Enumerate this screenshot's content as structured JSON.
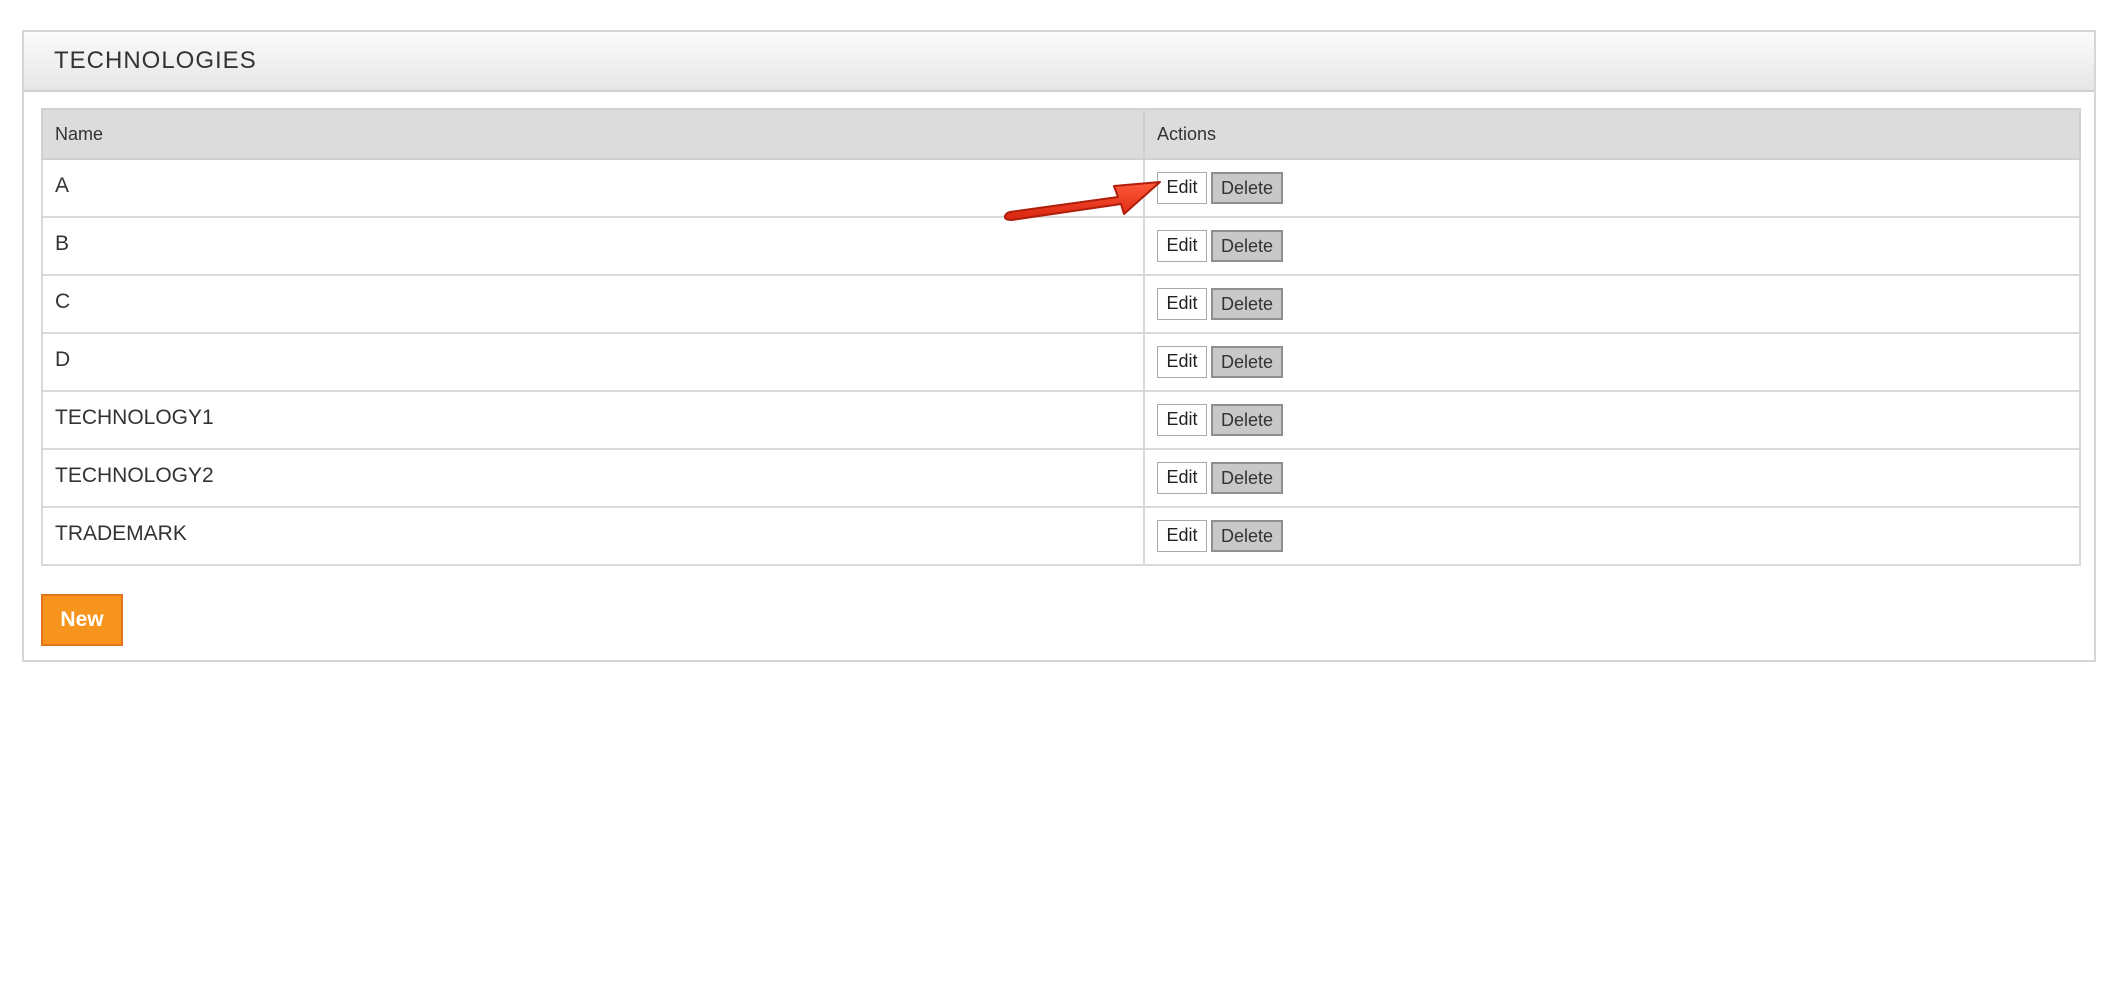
{
  "panel": {
    "title": "TECHNOLOGIES"
  },
  "table": {
    "headers": {
      "name": "Name",
      "actions": "Actions"
    },
    "rows": [
      {
        "name": "A",
        "edit_label": "Edit",
        "delete_label": "Delete"
      },
      {
        "name": "B",
        "edit_label": "Edit",
        "delete_label": "Delete"
      },
      {
        "name": "C",
        "edit_label": "Edit",
        "delete_label": "Delete"
      },
      {
        "name": "D",
        "edit_label": "Edit",
        "delete_label": "Delete"
      },
      {
        "name": "TECHNOLOGY1",
        "edit_label": "Edit",
        "delete_label": "Delete"
      },
      {
        "name": "TECHNOLOGY2",
        "edit_label": "Edit",
        "delete_label": "Delete"
      },
      {
        "name": "TRADEMARK",
        "edit_label": "Edit",
        "delete_label": "Delete"
      }
    ]
  },
  "footer": {
    "new_label": "New"
  },
  "colors": {
    "accent": "#f7941d",
    "annotation_arrow": "#e8341c"
  }
}
